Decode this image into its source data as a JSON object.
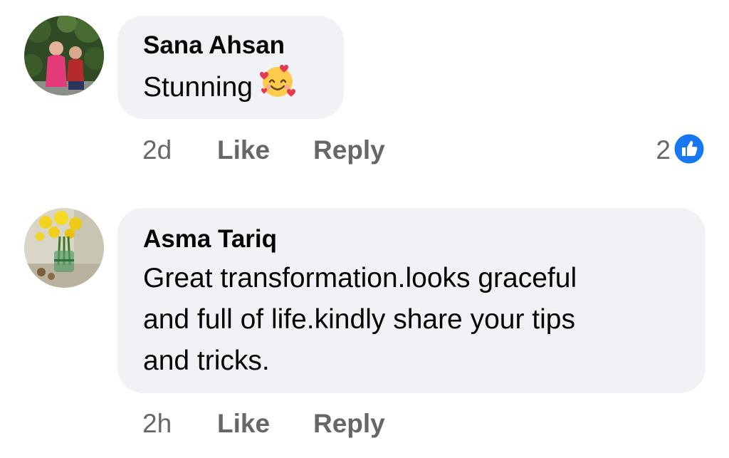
{
  "comments": [
    {
      "author": "Sana Ahsan",
      "text": "Stunning",
      "emoji": "smiling-face-with-hearts-icon",
      "time": "2d",
      "like_label": "Like",
      "reply_label": "Reply",
      "reaction_count": "2",
      "reaction_icon": "like-reaction-icon"
    },
    {
      "author": "Asma Tariq",
      "lines": [
        "Great  transformation.looks graceful",
        "and full of life.kindly share your tips",
        "and tricks."
      ],
      "time": "2h",
      "like_label": "Like",
      "reply_label": "Reply"
    }
  ],
  "colors": {
    "bubble": "#f0f2f5",
    "meta_text": "#65676b",
    "like_blue": "#1877f2"
  }
}
